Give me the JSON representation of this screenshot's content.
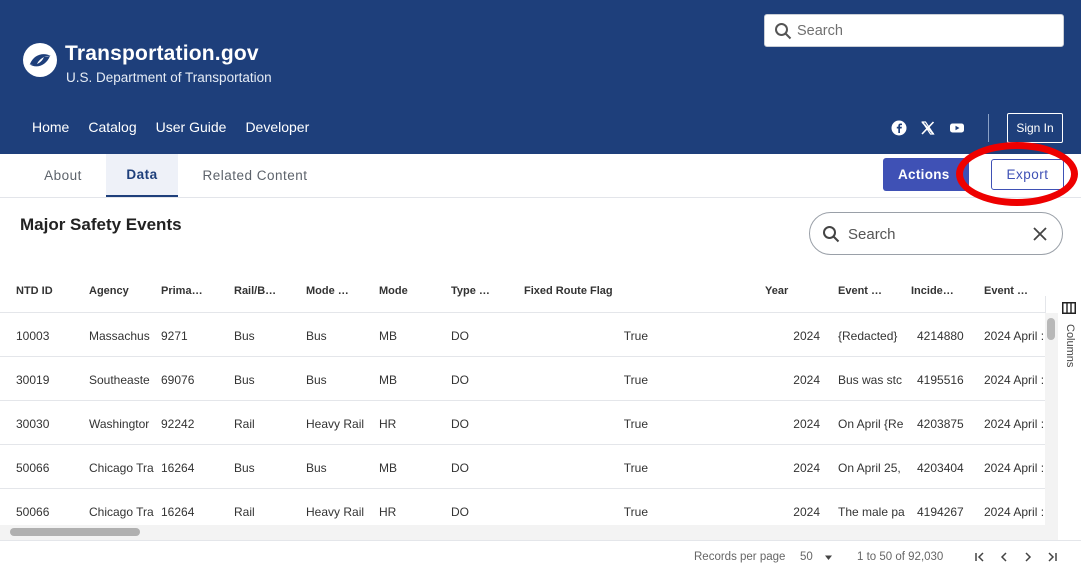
{
  "header": {
    "brand_title": "Transportation.gov",
    "brand_subtitle": "U.S. Department of Transportation",
    "search_placeholder": "Search",
    "nav": [
      "Home",
      "Catalog",
      "User Guide",
      "Developer"
    ],
    "social_icons": [
      "facebook-icon",
      "x-icon",
      "youtube-icon"
    ],
    "sign_in": "Sign In"
  },
  "tabs": [
    "About",
    "Data",
    "Related Content"
  ],
  "active_tab": "Data",
  "toolbar": {
    "actions_label": "Actions",
    "export_label": "Export"
  },
  "page_title": "Major Safety Events",
  "grid_search_placeholder": "Search",
  "grid": {
    "columns": [
      "NTD ID",
      "Agency",
      "Prima…",
      "Rail/B…",
      "Mode …",
      "Mode",
      "Type …",
      "Fixed Route Flag",
      "Year",
      "Event …",
      "Incide…",
      "Event …",
      "I"
    ],
    "rows": [
      [
        "10003",
        "Massachus",
        "9271",
        "Bus",
        "Bus",
        "MB",
        "DO",
        "True",
        "2024",
        "{Redacted}",
        "4214880",
        "2024 April :"
      ],
      [
        "30019",
        "Southeaste",
        "69076",
        "Bus",
        "Bus",
        "MB",
        "DO",
        "True",
        "2024",
        "Bus was stc",
        "4195516",
        "2024 April :"
      ],
      [
        "30030",
        "Washingtor",
        "92242",
        "Rail",
        "Heavy Rail",
        "HR",
        "DO",
        "True",
        "2024",
        "On April {Re",
        "4203875",
        "2024 April :"
      ],
      [
        "50066",
        "Chicago Tra",
        "16264",
        "Bus",
        "Bus",
        "MB",
        "DO",
        "True",
        "2024",
        "On April 25,",
        "4203404",
        "2024 April :"
      ],
      [
        "50066",
        "Chicago Tra",
        "16264",
        "Rail",
        "Heavy Rail",
        "HR",
        "DO",
        "True",
        "2024",
        "The male pa",
        "4194267",
        "2024 April :"
      ]
    ],
    "side_panel_label": "Columns"
  },
  "pagination": {
    "records_per_page_label": "Records per page",
    "records_per_page_value": "50",
    "range": "1 to 50 of 92,030"
  },
  "colors": {
    "header_bg": "#1e3f7b",
    "actions_bg": "#3f51b5",
    "annotation_circle": "#ee0000"
  }
}
